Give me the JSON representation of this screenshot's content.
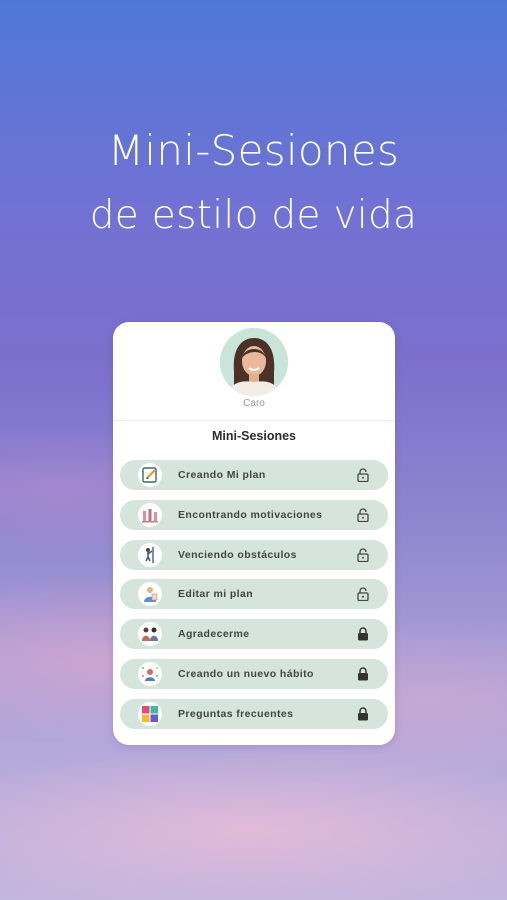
{
  "headline": {
    "line1": "Mini-Sesiones",
    "line2": "de estilo de vida"
  },
  "card": {
    "coach_name": "Caro",
    "section_title": "Mini-Sesiones",
    "items": [
      {
        "label": "Creando Mi plan",
        "icon": "notepad-pencil-icon",
        "status": "unlocked"
      },
      {
        "label": "Encontrando motivaciones",
        "icon": "motivation-bottles-icon",
        "status": "unlocked"
      },
      {
        "label": "Venciendo obstáculos",
        "icon": "climbing-person-icon",
        "status": "unlocked"
      },
      {
        "label": "Editar mi plan",
        "icon": "edit-plan-person-icon",
        "status": "unlocked"
      },
      {
        "label": "Agradecerme",
        "icon": "gratitude-people-icon",
        "status": "locked"
      },
      {
        "label": "Creando un nuevo hábito",
        "icon": "new-habit-icon",
        "status": "locked"
      },
      {
        "label": "Preguntas frecuentes",
        "icon": "faq-puzzle-icon",
        "status": "locked"
      }
    ]
  },
  "colors": {
    "item_background": "#d5e5db",
    "avatar_background": "#c9e4d8",
    "text_dark": "#444444"
  }
}
